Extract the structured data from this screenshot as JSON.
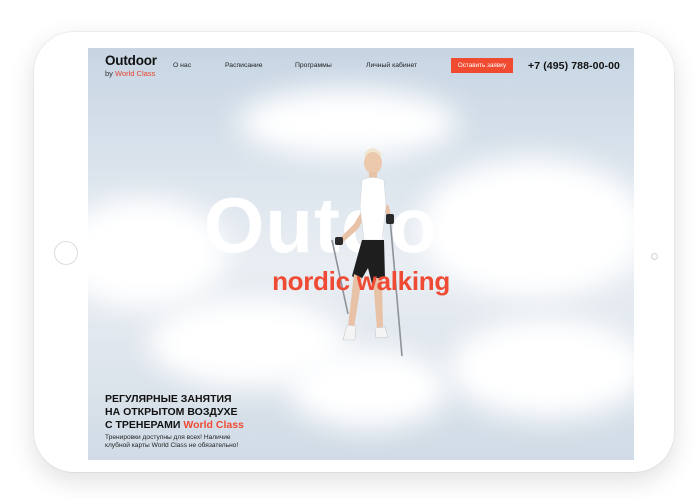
{
  "logo": {
    "title": "Outdoor",
    "by": "by",
    "brand": "World Class"
  },
  "nav": {
    "items": [
      "О нас",
      "Расписание",
      "Программы",
      "Личный кабинет"
    ]
  },
  "cta": {
    "label": "Оставить заявку"
  },
  "phone": "+7 (495) 788-00-00",
  "hero": {
    "title": "Outdoor",
    "subtitle": "nordic walking"
  },
  "tagline": {
    "line1": "РЕГУЛЯРНЫЕ ЗАНЯТИЯ",
    "line2": "НА ОТКРЫТОМ ВОЗДУХЕ",
    "line3": "С ТРЕНЕРАМИ",
    "brand": "World Class"
  },
  "note": {
    "text": "Тренировки доступны для всех! Наличие клубной карты World Class не обязательно!"
  },
  "colors": {
    "accent": "#ef4a33",
    "cta": "#f04a30",
    "text": "#111111"
  }
}
